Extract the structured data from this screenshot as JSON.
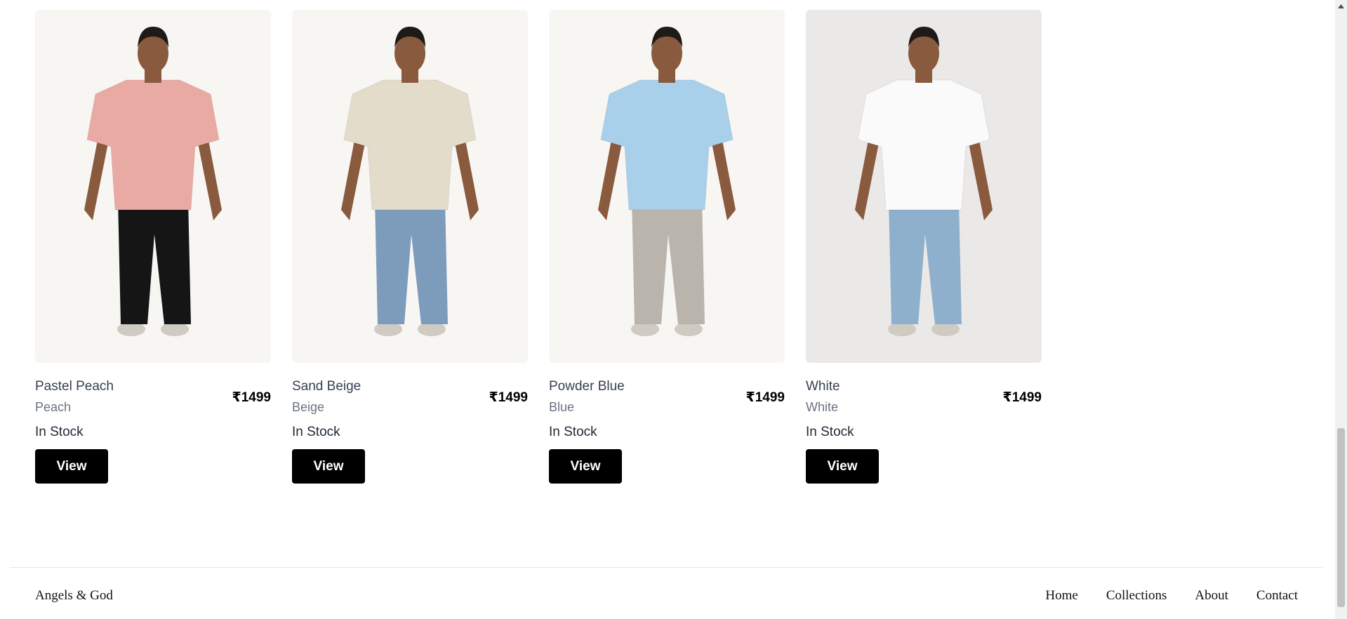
{
  "products": [
    {
      "name": "Pastel Peach",
      "variant": "Peach",
      "price": "₹1499",
      "stock": "In Stock",
      "button_label": "View",
      "shirt_color": "#e9aaa3",
      "pants_color": "#151515",
      "backdrop": "#f8f6f3"
    },
    {
      "name": "Sand Beige",
      "variant": "Beige",
      "price": "₹1499",
      "stock": "In Stock",
      "button_label": "View",
      "shirt_color": "#e4dccb",
      "pants_color": "#7d9cbc",
      "backdrop": "#f8f6f3"
    },
    {
      "name": "Powder Blue",
      "variant": "Blue",
      "price": "₹1499",
      "stock": "In Stock",
      "button_label": "View",
      "shirt_color": "#a8d0ea",
      "pants_color": "#b9b5ad",
      "backdrop": "#f8f6f3"
    },
    {
      "name": "White",
      "variant": "White",
      "price": "₹1499",
      "stock": "In Stock",
      "button_label": "View",
      "shirt_color": "#fafafa",
      "pants_color": "#8fb0cc",
      "backdrop": "#ebe9e7"
    }
  ],
  "footer": {
    "brand": "Angels & God",
    "nav": [
      "Home",
      "Collections",
      "About",
      "Contact"
    ]
  }
}
